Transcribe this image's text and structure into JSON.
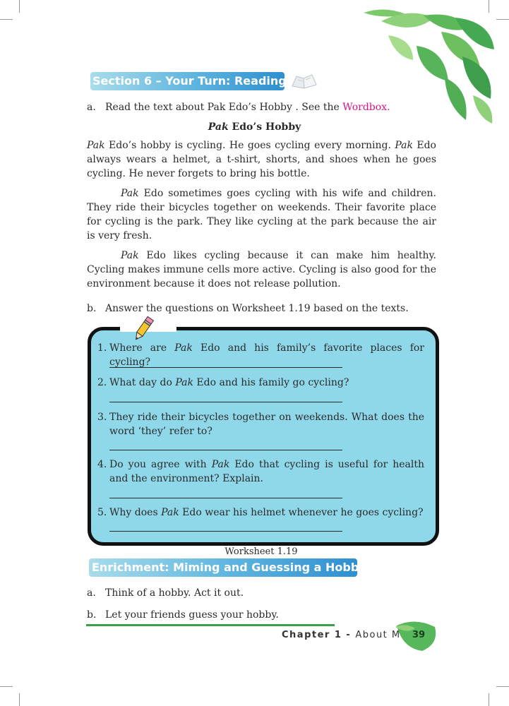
{
  "section6": {
    "title": "Section 6 – Your Turn: Reading",
    "instruction_a_prefix": "a.",
    "instruction_a_text": "Read the text about Pak Edo’s Hobby . See the ",
    "instruction_a_link": "Wordbox.",
    "passage_title_italic": "Pak",
    "passage_title_rest": " Edo’s Hobby",
    "p1_pak1": "Pak",
    "p1_a": " Edo’s hobby is cycling. He goes cycling every morning. ",
    "p1_pak2": "Pak",
    "p1_b": " Edo always wears a helmet, a t-shirt, shorts, and shoes when he goes cycling. He never forgets to bring his bottle.",
    "p2_pak": "Pak",
    "p2_text": " Edo sometimes goes cycling with his wife and children. They ride their bicycles together on weekends. Their favorite place for cycling is the park. They like cycling at the park because the air is very fresh.",
    "p3_pak": "Pak",
    "p3_text": " Edo likes cycling because it can make him healthy. Cycling makes immune cells more active. Cycling is also good for the environment because it does not release pollution.",
    "instruction_b_prefix": "b.",
    "instruction_b_text": "Answer the questions on Worksheet 1.19 based on the texts."
  },
  "worksheet": {
    "caption": "Worksheet 1.19",
    "questions": [
      {
        "num": "1.",
        "a": "Where are ",
        "pak": "Pak",
        "b": " Edo and his family’s favorite places for cycling?"
      },
      {
        "num": "2.",
        "a": "What day do ",
        "pak": "Pak",
        "b": " Edo and his family go cycling?"
      },
      {
        "num": "3.",
        "a": "They ride their bicycles together on weekends. What does the word ‘they’ refer to?",
        "pak": "",
        "b": ""
      },
      {
        "num": "4.",
        "a": "Do you agree with ",
        "pak": "Pak",
        "b": " Edo that cycling is useful for health and the environment? Explain."
      },
      {
        "num": "5.",
        "a": "Why does ",
        "pak": "Pak",
        "b": " Edo wear his helmet whenever he goes cycling?"
      }
    ]
  },
  "enrichment": {
    "title": "Enrichment: Miming and Guessing a Hobby",
    "item_a_prefix": "a.",
    "item_a_text": "Think of a hobby. Act it out.",
    "item_b_prefix": "b.",
    "item_b_text": "Let your friends guess your hobby."
  },
  "footer": {
    "chapter_label": "Chapter 1 - ",
    "chapter_title": "About Me",
    "page_number": "39"
  },
  "colors": {
    "section_bar_light": "#a8dceb",
    "section_bar_dark": "#2f8fd0",
    "wordbox_link": "#d4148c",
    "worksheet_fill": "#8fd8ea",
    "leaf_green": "#56b85a",
    "footer_rule": "#3aa04a"
  },
  "icons": [
    "book-icon",
    "pencil-icon",
    "leaf-decoration",
    "page-number-leaf"
  ]
}
